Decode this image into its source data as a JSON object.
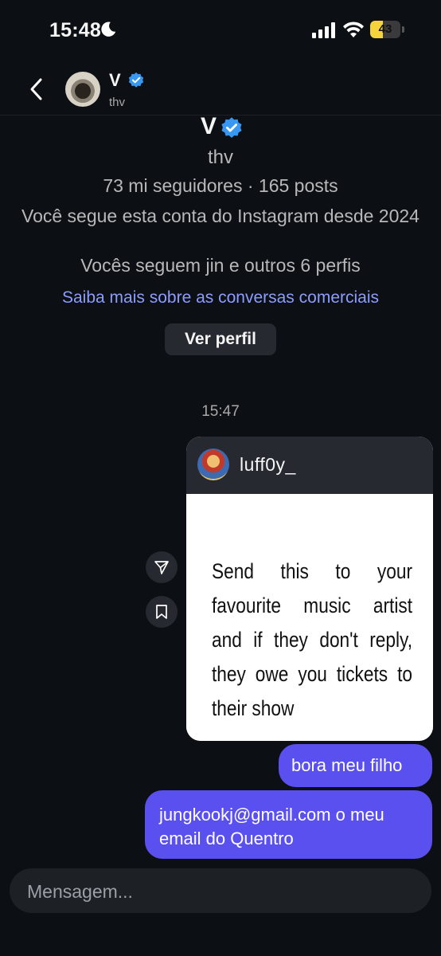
{
  "status": {
    "time": "15:48",
    "battery_level": "43",
    "battery_percent": 43
  },
  "header": {
    "name": "V",
    "handle": "thv"
  },
  "profile": {
    "name": "V",
    "handle": "thv",
    "stats": "73 mi seguidores · 165 posts",
    "since": "Você segue esta conta do Instagram desde 2024",
    "mutual": "Vocês seguem jin e outros 6 perfis",
    "link": "Saiba mais sobre as conversas comerciais",
    "view_button": "Ver perfil"
  },
  "conversation": {
    "timestamp": "15:47",
    "shared_post": {
      "username": "luff0y_",
      "text": "Send this to your favourite music artist and if they don't reply, they owe you tickets to their show"
    },
    "messages": [
      {
        "text": "bora meu filho"
      },
      {
        "text": "jungkookj@gmail.com o meu email do Quentro"
      }
    ]
  },
  "composer": {
    "placeholder": "Mensagem..."
  },
  "colors": {
    "background": "#0c1014",
    "bubble": "#5a50f0",
    "link": "#8c9cff",
    "verified": "#3897f0",
    "battery": "#f5d33d"
  }
}
